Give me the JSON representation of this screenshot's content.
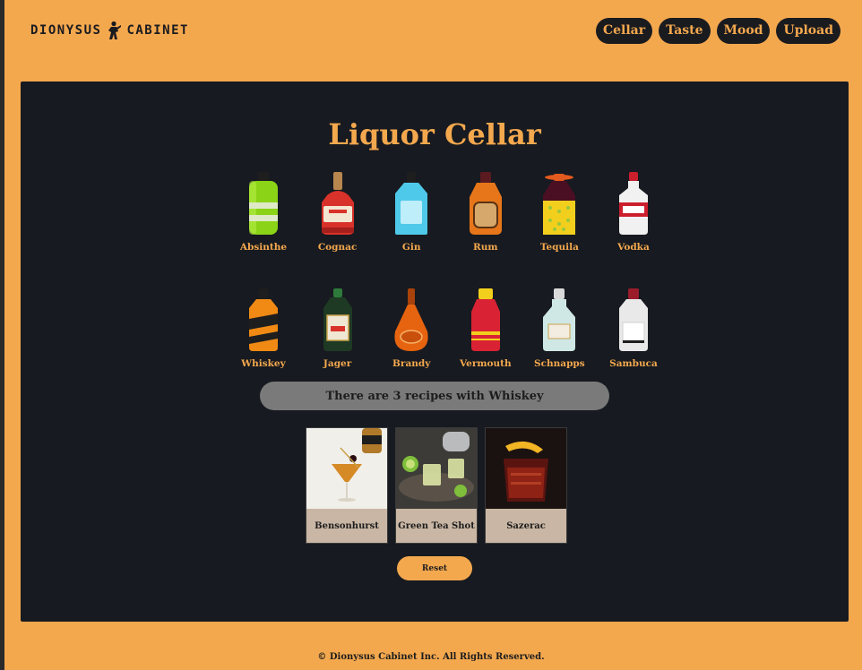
{
  "brand": {
    "part1": "DIONYSUS",
    "part2": "CABINET"
  },
  "nav": [
    {
      "label": "Cellar"
    },
    {
      "label": "Taste"
    },
    {
      "label": "Mood"
    },
    {
      "label": "Upload"
    }
  ],
  "main": {
    "title": "Liquor Cellar",
    "liquors": [
      {
        "label": "Absinthe",
        "icon": "absinthe-bottle-icon",
        "color": "#8ad317"
      },
      {
        "label": "Cognac",
        "icon": "cognac-bottle-icon",
        "color": "#d8322a"
      },
      {
        "label": "Gin",
        "icon": "gin-bottle-icon",
        "color": "#4fc9ea"
      },
      {
        "label": "Rum",
        "icon": "rum-bottle-icon",
        "color": "#e67619"
      },
      {
        "label": "Tequila",
        "icon": "tequila-bottle-icon",
        "color": "#f2cf1d"
      },
      {
        "label": "Vodka",
        "icon": "vodka-bottle-icon",
        "color": "#f1f1f1"
      },
      {
        "label": "Whiskey",
        "icon": "whiskey-bottle-icon",
        "color": "#f08a14"
      },
      {
        "label": "Jager",
        "icon": "jager-bottle-icon",
        "color": "#1f3a24"
      },
      {
        "label": "Brandy",
        "icon": "brandy-bottle-icon",
        "color": "#e6630f"
      },
      {
        "label": "Vermouth",
        "icon": "vermouth-bottle-icon",
        "color": "#d92234"
      },
      {
        "label": "Schnapps",
        "icon": "schnapps-bottle-icon",
        "color": "#cfe8e6"
      },
      {
        "label": "Sambuca",
        "icon": "sambuca-bottle-icon",
        "color": "#e9e9e9"
      }
    ],
    "status": "There are 3 recipes with Whiskey",
    "recipes": [
      {
        "name": "Bensonhurst",
        "photo": "cocktail-photo-bensonhurst"
      },
      {
        "name": "Green Tea Shot",
        "photo": "cocktail-photo-green-tea-shot"
      },
      {
        "name": "Sazerac",
        "photo": "cocktail-photo-sazerac"
      }
    ],
    "reset_label": "Reset"
  },
  "footer": {
    "text": "© Dionysus Cabinet Inc. All Rights Reserved."
  },
  "colors": {
    "accent": "#f4a84e",
    "panel": "#171a20",
    "status_bg": "#7a7a7a",
    "card_bg": "#c9b6a4"
  }
}
